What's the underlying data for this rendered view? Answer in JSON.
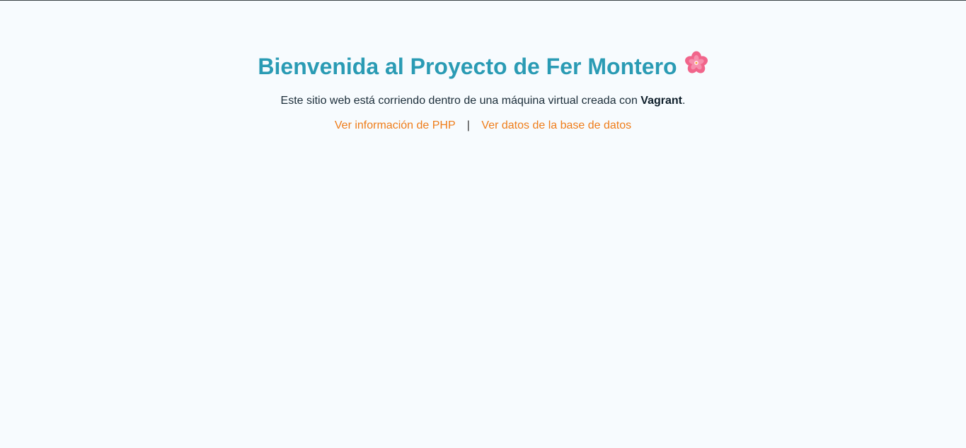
{
  "header": {
    "title": "Bienvenida al Proyecto de Fer Montero",
    "title_icon": "cherry-blossom-icon"
  },
  "intro": {
    "text_before": "Este sitio web está corriendo dentro de una máquina virtual creada con ",
    "highlight": "Vagrant",
    "text_after": "."
  },
  "links": {
    "php_info": "Ver información de PHP",
    "separator": "|",
    "db_data": "Ver datos de la base de datos"
  },
  "colors": {
    "title": "#2a9bb4",
    "link": "#ef7d1a",
    "background": "#f7fbfe"
  }
}
